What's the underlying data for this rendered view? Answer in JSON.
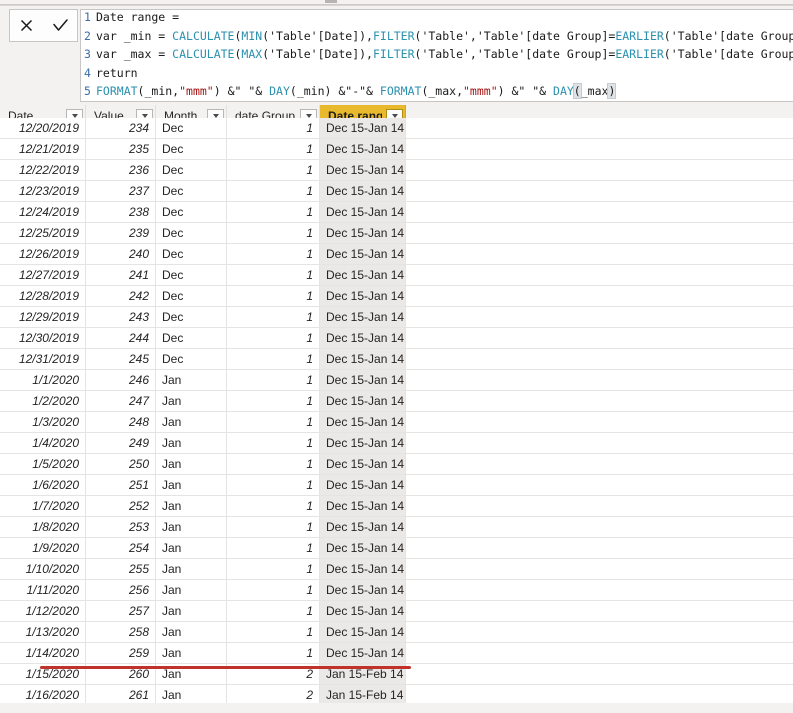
{
  "app": {
    "product": "Power BI Desktop",
    "view": "data-view-formula-editor"
  },
  "formula_bar": {
    "cancel_label": "✕",
    "commit_label": "✓",
    "cancel_name": "cancel-edit",
    "commit_name": "commit-edit",
    "lines": [
      {
        "number": "1",
        "text": "Date range ="
      },
      {
        "number": "2",
        "text": "var _min = CALCULATE(MIN('Table'[Date]),FILTER('Table','Table'[date Group]=EARLIER('Table'[date Group])))"
      },
      {
        "number": "3",
        "text": "var _max = CALCULATE(MAX('Table'[Date]),FILTER('Table','Table'[date Group]=EARLIER('Table'[date Group])))"
      },
      {
        "number": "4",
        "text": "return"
      },
      {
        "number": "5",
        "text": "FORMAT(_min,\"mmm\") &\" \"& DAY(_min) &\"-\"& FORMAT(_max,\"mmm\") &\" \"& DAY(_max)"
      }
    ],
    "measure_name": "Date range",
    "caret_after": "DAY(_max)"
  },
  "grid": {
    "columns": [
      {
        "key": "date",
        "label": "Date",
        "width": 86,
        "align": "right",
        "active": false
      },
      {
        "key": "value",
        "label": "Value",
        "width": 70,
        "align": "right",
        "active": false
      },
      {
        "key": "month",
        "label": "Month",
        "width": 71,
        "align": "left",
        "active": false
      },
      {
        "key": "group",
        "label": "date Group",
        "width": 93,
        "align": "right",
        "active": false
      },
      {
        "key": "range",
        "label": "Date range",
        "width": 86,
        "align": "left",
        "active": true
      }
    ],
    "rows": [
      {
        "date": "12/20/2019",
        "value": "234",
        "month": "Dec",
        "group": "1",
        "range": "Dec 15-Jan 14"
      },
      {
        "date": "12/21/2019",
        "value": "235",
        "month": "Dec",
        "group": "1",
        "range": "Dec 15-Jan 14"
      },
      {
        "date": "12/22/2019",
        "value": "236",
        "month": "Dec",
        "group": "1",
        "range": "Dec 15-Jan 14"
      },
      {
        "date": "12/23/2019",
        "value": "237",
        "month": "Dec",
        "group": "1",
        "range": "Dec 15-Jan 14"
      },
      {
        "date": "12/24/2019",
        "value": "238",
        "month": "Dec",
        "group": "1",
        "range": "Dec 15-Jan 14"
      },
      {
        "date": "12/25/2019",
        "value": "239",
        "month": "Dec",
        "group": "1",
        "range": "Dec 15-Jan 14"
      },
      {
        "date": "12/26/2019",
        "value": "240",
        "month": "Dec",
        "group": "1",
        "range": "Dec 15-Jan 14"
      },
      {
        "date": "12/27/2019",
        "value": "241",
        "month": "Dec",
        "group": "1",
        "range": "Dec 15-Jan 14"
      },
      {
        "date": "12/28/2019",
        "value": "242",
        "month": "Dec",
        "group": "1",
        "range": "Dec 15-Jan 14"
      },
      {
        "date": "12/29/2019",
        "value": "243",
        "month": "Dec",
        "group": "1",
        "range": "Dec 15-Jan 14"
      },
      {
        "date": "12/30/2019",
        "value": "244",
        "month": "Dec",
        "group": "1",
        "range": "Dec 15-Jan 14"
      },
      {
        "date": "12/31/2019",
        "value": "245",
        "month": "Dec",
        "group": "1",
        "range": "Dec 15-Jan 14"
      },
      {
        "date": "1/1/2020",
        "value": "246",
        "month": "Jan",
        "group": "1",
        "range": "Dec 15-Jan 14"
      },
      {
        "date": "1/2/2020",
        "value": "247",
        "month": "Jan",
        "group": "1",
        "range": "Dec 15-Jan 14"
      },
      {
        "date": "1/3/2020",
        "value": "248",
        "month": "Jan",
        "group": "1",
        "range": "Dec 15-Jan 14"
      },
      {
        "date": "1/4/2020",
        "value": "249",
        "month": "Jan",
        "group": "1",
        "range": "Dec 15-Jan 14"
      },
      {
        "date": "1/5/2020",
        "value": "250",
        "month": "Jan",
        "group": "1",
        "range": "Dec 15-Jan 14"
      },
      {
        "date": "1/6/2020",
        "value": "251",
        "month": "Jan",
        "group": "1",
        "range": "Dec 15-Jan 14"
      },
      {
        "date": "1/7/2020",
        "value": "252",
        "month": "Jan",
        "group": "1",
        "range": "Dec 15-Jan 14"
      },
      {
        "date": "1/8/2020",
        "value": "253",
        "month": "Jan",
        "group": "1",
        "range": "Dec 15-Jan 14"
      },
      {
        "date": "1/9/2020",
        "value": "254",
        "month": "Jan",
        "group": "1",
        "range": "Dec 15-Jan 14"
      },
      {
        "date": "1/10/2020",
        "value": "255",
        "month": "Jan",
        "group": "1",
        "range": "Dec 15-Jan 14"
      },
      {
        "date": "1/11/2020",
        "value": "256",
        "month": "Jan",
        "group": "1",
        "range": "Dec 15-Jan 14"
      },
      {
        "date": "1/12/2020",
        "value": "257",
        "month": "Jan",
        "group": "1",
        "range": "Dec 15-Jan 14"
      },
      {
        "date": "1/13/2020",
        "value": "258",
        "month": "Jan",
        "group": "1",
        "range": "Dec 15-Jan 14"
      },
      {
        "date": "1/14/2020",
        "value": "259",
        "month": "Jan",
        "group": "1",
        "range": "Dec 15-Jan 14"
      },
      {
        "date": "1/15/2020",
        "value": "260",
        "month": "Jan",
        "group": "2",
        "range": "Jan 15-Feb 14"
      },
      {
        "date": "1/16/2020",
        "value": "261",
        "month": "Jan",
        "group": "2",
        "range": "Jan 15-Feb 14"
      }
    ]
  },
  "annotation": {
    "type": "horizontal-rule",
    "color": "#c1322b",
    "between_rows": [
      "1/14/2020",
      "1/15/2020"
    ],
    "meaning": "group boundary"
  },
  "colors": {
    "accent_header": "#e8b92d",
    "chrome": "#f3f2f1",
    "grid_line": "#e6e4e2",
    "range_cell_bg": "#ebe9e7",
    "keyword": "#2b91af",
    "string": "#a31515",
    "line_number": "#3b6ea5",
    "annotation": "#c1322b"
  }
}
